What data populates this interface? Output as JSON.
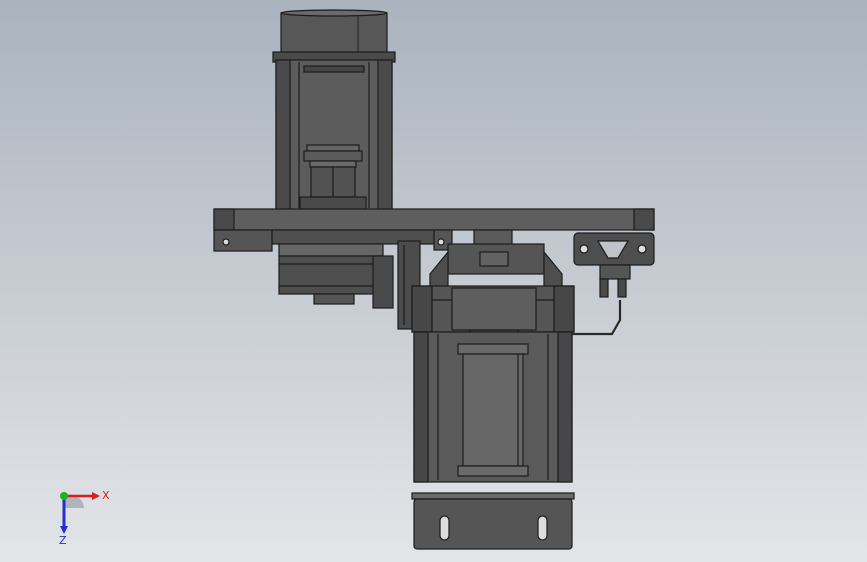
{
  "viewport": {
    "background_top": "#aab3be",
    "background_bottom": "#e3e5e8",
    "part_fill": "#5a5a5a",
    "part_fill_dark": "#3e3e3e",
    "part_fill_light": "#727272",
    "edge_color": "#1c1c1c"
  },
  "triad": {
    "x_label": "X",
    "z_label": "Z",
    "x_color": "#d62020",
    "y_color": "#20b020",
    "z_color": "#2030d0"
  }
}
